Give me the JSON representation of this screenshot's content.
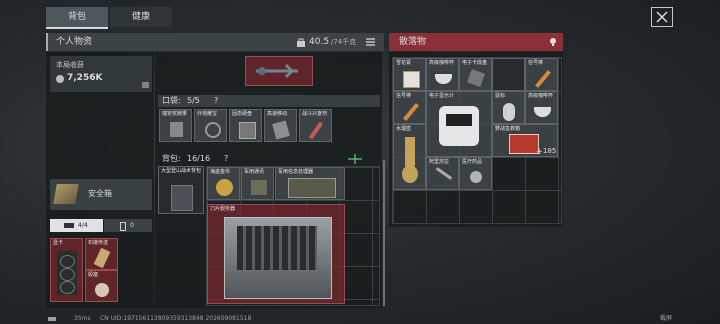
{
  "tabs": [
    {
      "label": "背包",
      "active": true
    },
    {
      "label": "健康",
      "active": false
    }
  ],
  "left_panel": {
    "title": "个人物资",
    "weight": "40.5",
    "weight_max": "/74千克",
    "earnings_label": "本局收获",
    "earnings_value": "7,256K",
    "safebox_label": "安全箱",
    "mini_tabs": [
      {
        "value": "4/4"
      },
      {
        "value": "0"
      }
    ],
    "side_slots": [
      {
        "label": "显卡"
      },
      {
        "label": "石墩传送"
      },
      {
        "label": "骰塞"
      }
    ]
  },
  "pocket": {
    "label": "口袋:",
    "count": "5/5",
    "help": "?",
    "items": [
      {
        "label": "瑞安奖牌果"
      },
      {
        "label": "外观耀宝"
      },
      {
        "label": "固态硬盘"
      },
      {
        "label": "高速移动"
      },
      {
        "label": "战斗兴奋剂"
      }
    ]
  },
  "backpack": {
    "label": "背包:",
    "count": "16/16",
    "help": "?",
    "bag_label": "大型登山战术背包",
    "items": [
      {
        "label": "海盗金币"
      },
      {
        "label": "军用通讯"
      },
      {
        "label": "军用信息处理器"
      },
      {
        "label": "刀片服务器"
      }
    ]
  },
  "loot": {
    "title": "散落物",
    "items": [
      {
        "label": "雪花膏"
      },
      {
        "label": "高级咖啡杯"
      },
      {
        "label": "电子卡底盘"
      },
      {
        "label": "信号棒"
      },
      {
        "label": "信号棒"
      },
      {
        "label": "电子显示计"
      },
      {
        "label": "鼠标"
      },
      {
        "label": "高级咖啡杯"
      },
      {
        "label": "水烟壶"
      },
      {
        "label": "野战急救箱"
      },
      {
        "label": "阿里苏拉"
      },
      {
        "label": "医疗药品"
      }
    ],
    "medkit_count": "185"
  },
  "status": {
    "fps": "35ms",
    "uid": "CN UID:197156113809359313848 202609081518",
    "right": "截屏"
  },
  "colors": {
    "accent_red": "#8b3038",
    "header_bg": "#3b4347",
    "active_tab": "#4a5357"
  }
}
